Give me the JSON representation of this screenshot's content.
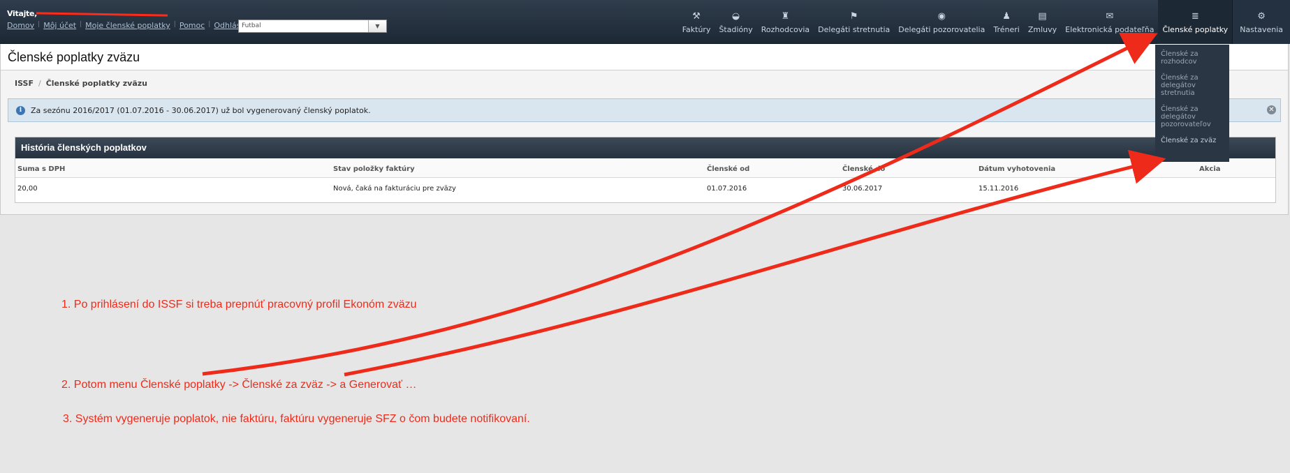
{
  "header": {
    "welcome": "Vitajte,",
    "links": [
      "Domov",
      "Môj účet",
      "Moje členské poplatky",
      "Pomoc",
      "Odhlásiť"
    ],
    "sport_select": "Futbal"
  },
  "nav": {
    "items": [
      {
        "label": "Faktúry",
        "icon": "invoice-icon"
      },
      {
        "label": "Štadióny",
        "icon": "stadium-icon"
      },
      {
        "label": "Rozhodcovia",
        "icon": "referee-icon"
      },
      {
        "label": "Delegáti stretnutia",
        "icon": "delegate-icon"
      },
      {
        "label": "Delegáti pozorovatelia",
        "icon": "observer-icon"
      },
      {
        "label": "Tréneri",
        "icon": "coach-icon"
      },
      {
        "label": "Zmluvy",
        "icon": "contract-icon"
      },
      {
        "label": "Elektronická podateľňa",
        "icon": "mail-icon"
      },
      {
        "label": "Členské poplatky",
        "icon": "fees-icon"
      },
      {
        "label": "Nastavenia",
        "icon": "settings-icon"
      }
    ],
    "dropdown": [
      "Členské za rozhodcov",
      "Členské za delegátov stretnutia",
      "Členské za delegátov pozorovateľov",
      "Členské za zväz"
    ]
  },
  "page": {
    "title": "Členské poplatky zväzu",
    "breadcrumb": [
      "ISSF",
      "Členské poplatky zväzu"
    ],
    "alert": "Za sezónu 2016/2017 (01.07.2016 - 30.06.2017) už bol vygenerovaný členský poplatok."
  },
  "table": {
    "title": "História členských poplatkov",
    "columns": [
      "Suma s DPH",
      "Stav položky faktúry",
      "Členské od",
      "Členské do",
      "Dátum vyhotovenia",
      "Akcia"
    ],
    "rows": [
      [
        "20,00",
        "Nová, čaká na fakturáciu pre zväzy",
        "01.07.2016",
        "30.06.2017",
        "15.11.2016",
        ""
      ]
    ]
  },
  "annotations": {
    "step1": "1. Po prihlásení do ISSF si treba prepnúť pracovný profil Ekonóm zväzu",
    "step2": "2. Potom menu Členské poplatky -> Členské za zväz -> a Generovať …",
    "step3": "3. Systém vygeneruje poplatok, nie faktúru, faktúru vygeneruje SFZ o čom budete notifikovaní."
  },
  "colors": {
    "annotation": "#ee2b1a",
    "topbar": "#1d2835"
  }
}
